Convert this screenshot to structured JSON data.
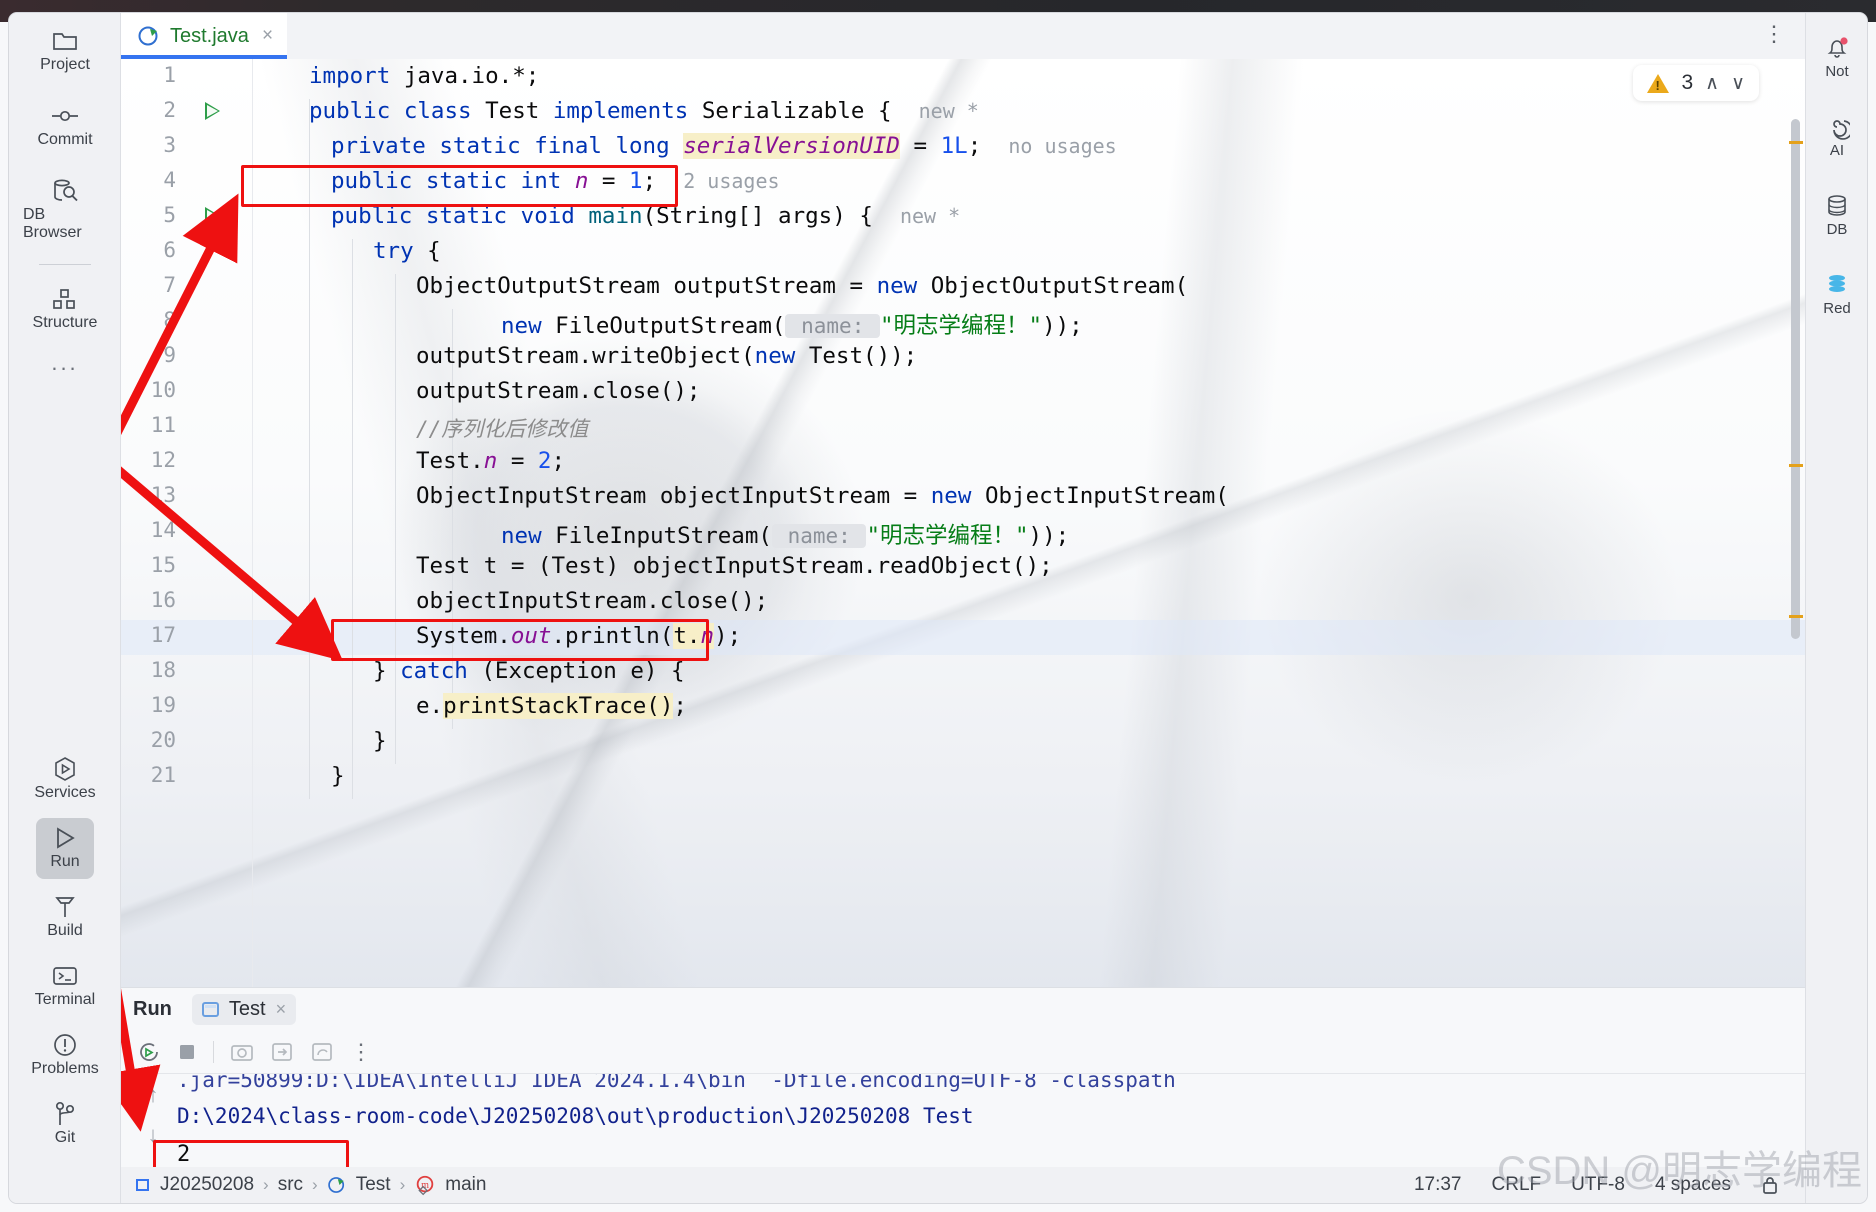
{
  "window": {
    "title_strip_color": "#2e2a2c"
  },
  "left_rail": {
    "items": [
      {
        "label": "Project",
        "icon": "folder-icon",
        "selected": false
      },
      {
        "label": "Commit",
        "icon": "commit-icon",
        "selected": false
      },
      {
        "label": "DB Browser",
        "icon": "db-browser-icon",
        "selected": false
      },
      {
        "label": "Structure",
        "icon": "structure-icon",
        "selected": false
      },
      {
        "label": "...",
        "icon": "more-icon",
        "selected": false
      }
    ],
    "bottom_items": [
      {
        "label": "Services",
        "icon": "services-icon",
        "selected": false
      },
      {
        "label": "Run",
        "icon": "run-icon",
        "selected": true
      },
      {
        "label": "Build",
        "icon": "build-hammer-icon",
        "selected": false
      },
      {
        "label": "Terminal",
        "icon": "terminal-icon",
        "selected": false
      },
      {
        "label": "Problems",
        "icon": "problems-icon",
        "selected": false
      },
      {
        "label": "Git",
        "icon": "git-branch-icon",
        "selected": false
      }
    ]
  },
  "right_rail": {
    "items": [
      {
        "label": "Not",
        "icon": "notifications-bell-icon",
        "badge": true
      },
      {
        "label": "AI",
        "icon": "ai-assistant-icon",
        "badge": false
      },
      {
        "label": "DB",
        "icon": "database-icon",
        "badge": false
      },
      {
        "label": "Red",
        "icon": "redis-icon",
        "badge": false
      }
    ]
  },
  "tabs": [
    {
      "label": "Test.java",
      "icon": "java-class-run-icon",
      "close": "×",
      "active": true
    }
  ],
  "inspection_widget": {
    "count": "3",
    "icon": "warning-triangle-icon",
    "up": "∧",
    "down": "∨"
  },
  "editor": {
    "lines": [
      {
        "no": "1",
        "run": false,
        "indent": 0
      },
      {
        "no": "2",
        "run": true,
        "indent": 0
      },
      {
        "no": "3",
        "run": false,
        "indent": 1
      },
      {
        "no": "4",
        "run": false,
        "indent": 1
      },
      {
        "no": "5",
        "run": true,
        "indent": 1
      },
      {
        "no": "6",
        "run": false,
        "indent": 2
      },
      {
        "no": "7",
        "run": false,
        "indent": 3
      },
      {
        "no": "8",
        "run": false,
        "indent": 3
      },
      {
        "no": "9",
        "run": false,
        "indent": 3
      },
      {
        "no": "10",
        "run": false,
        "indent": 3
      },
      {
        "no": "11",
        "run": false,
        "indent": 3
      },
      {
        "no": "12",
        "run": false,
        "indent": 3
      },
      {
        "no": "13",
        "run": false,
        "indent": 3
      },
      {
        "no": "14",
        "run": false,
        "indent": 3
      },
      {
        "no": "15",
        "run": false,
        "indent": 3
      },
      {
        "no": "16",
        "run": false,
        "indent": 3
      },
      {
        "no": "17",
        "run": false,
        "indent": 3
      },
      {
        "no": "18",
        "run": false,
        "indent": 2
      },
      {
        "no": "19",
        "run": false,
        "indent": 3
      },
      {
        "no": "20",
        "run": false,
        "indent": 2
      },
      {
        "no": "21",
        "run": false,
        "indent": 1
      }
    ],
    "code": {
      "l1": "import java.io.*;",
      "l2": "public class Test implements Serializable {   new *",
      "l3": "private static final long serialVersionUID = 1L;   no usages",
      "l4": "public static int n = 1;   2 usages",
      "l5": "public static void main(String[] args) {   new *",
      "l6": "try {",
      "l7": "ObjectOutputStream outputStream = new ObjectOutputStream(",
      "l8": "new FileOutputStream( name: \"明志学编程！\"));",
      "l9": "outputStream.writeObject(new Test());",
      "l10": "outputStream.close();",
      "l11": "//序列化后修改值",
      "l12": "Test.n = 2;",
      "l13": "ObjectInputStream objectInputStream = new ObjectInputStream(",
      "l14": "new FileInputStream( name: \"明志学编程！\"));",
      "l15": "Test t = (Test) objectInputStream.readObject();",
      "l16": "objectInputStream.close();",
      "l17": "System.out.println(t.n);",
      "l18": "} catch (Exception e) {",
      "l19": "e.printStackTrace();",
      "l20": "}",
      "l21": "}"
    },
    "tokens": {
      "kw_import": "import",
      "java_io": " java.io.*;",
      "kw_public": "public",
      "kw_class": "class",
      "cls_Test": "Test",
      "kw_implements": "implements",
      "cls_Serializable": "Serializable",
      "brace_open": "{",
      "hint_new_star": "new *",
      "kw_private": "private",
      "kw_static": "static",
      "kw_final": "final",
      "kw_long": "long",
      "fld_serialVersionUID": "serialVersionUID",
      "eq": "=",
      "num_1L": "1L",
      "semi": ";",
      "hint_no_usages": "no usages",
      "kw_int": "int",
      "fld_n": "n",
      "num_1": "1",
      "hint_2_usages": "2 usages",
      "kw_void": "void",
      "mth_main": "main",
      "args_sig": "(String[] args)",
      "kw_try": "try",
      "t_ObjectOutputStream": "ObjectOutputStream",
      "v_outputStream": "outputStream",
      "kw_new": "new",
      "t_FileOutputStream": "FileOutputStream",
      "param_name": "name:",
      "str_chinese": "\"明志学编程！\"",
      "comment_cn": "//序列化后修改值",
      "num_2": "2",
      "t_ObjectInputStream": "ObjectInputStream",
      "v_objectInputStream": "objectInputStream",
      "t_FileInputStream": "FileInputStream",
      "kw_catch": "catch",
      "printStackTrace": "printStackTrace()"
    }
  },
  "run_window": {
    "title": "Run",
    "tab_label": "Test",
    "tab_close": "×",
    "toolbar_icons": [
      "rerun-icon",
      "stop-icon",
      "camera-icon",
      "export-icon",
      "profile-icon",
      "more-options-icon"
    ],
    "console_lines": [
      ".jar=50899:D:\\IDEA\\IntelliJ IDEA 2024.1.4\\bin  -Dfile.encoding=UTF-8 -classpath",
      "D:\\2024\\class-room-code\\J20250208\\out\\production\\J20250208 Test",
      "2"
    ],
    "side_icons": [
      "scroll-up-icon",
      "scroll-down-icon",
      "expand-icon"
    ]
  },
  "status_bar": {
    "breadcrumbs": [
      {
        "label": "J20250208",
        "icon": "module-icon"
      },
      {
        "label": "src",
        "icon": ""
      },
      {
        "label": "Test",
        "icon": "java-class-run-icon"
      },
      {
        "label": "main",
        "icon": "method-icon"
      }
    ],
    "separator": "›",
    "time": "17:37",
    "line_separator": "CRLF",
    "encoding": "UTF-8",
    "indent": "4 spaces",
    "lock_icon": "lock-icon"
  },
  "annotations": {
    "color": "#ee1111",
    "boxes": [
      "line-4-declaration-box",
      "line-17-println-box",
      "console-output-box"
    ],
    "arrows": [
      "arrow-to-line-4",
      "arrow-to-line-17",
      "arrow-to-console-output"
    ]
  },
  "watermark": {
    "text": "CSDN @明志学编程"
  }
}
